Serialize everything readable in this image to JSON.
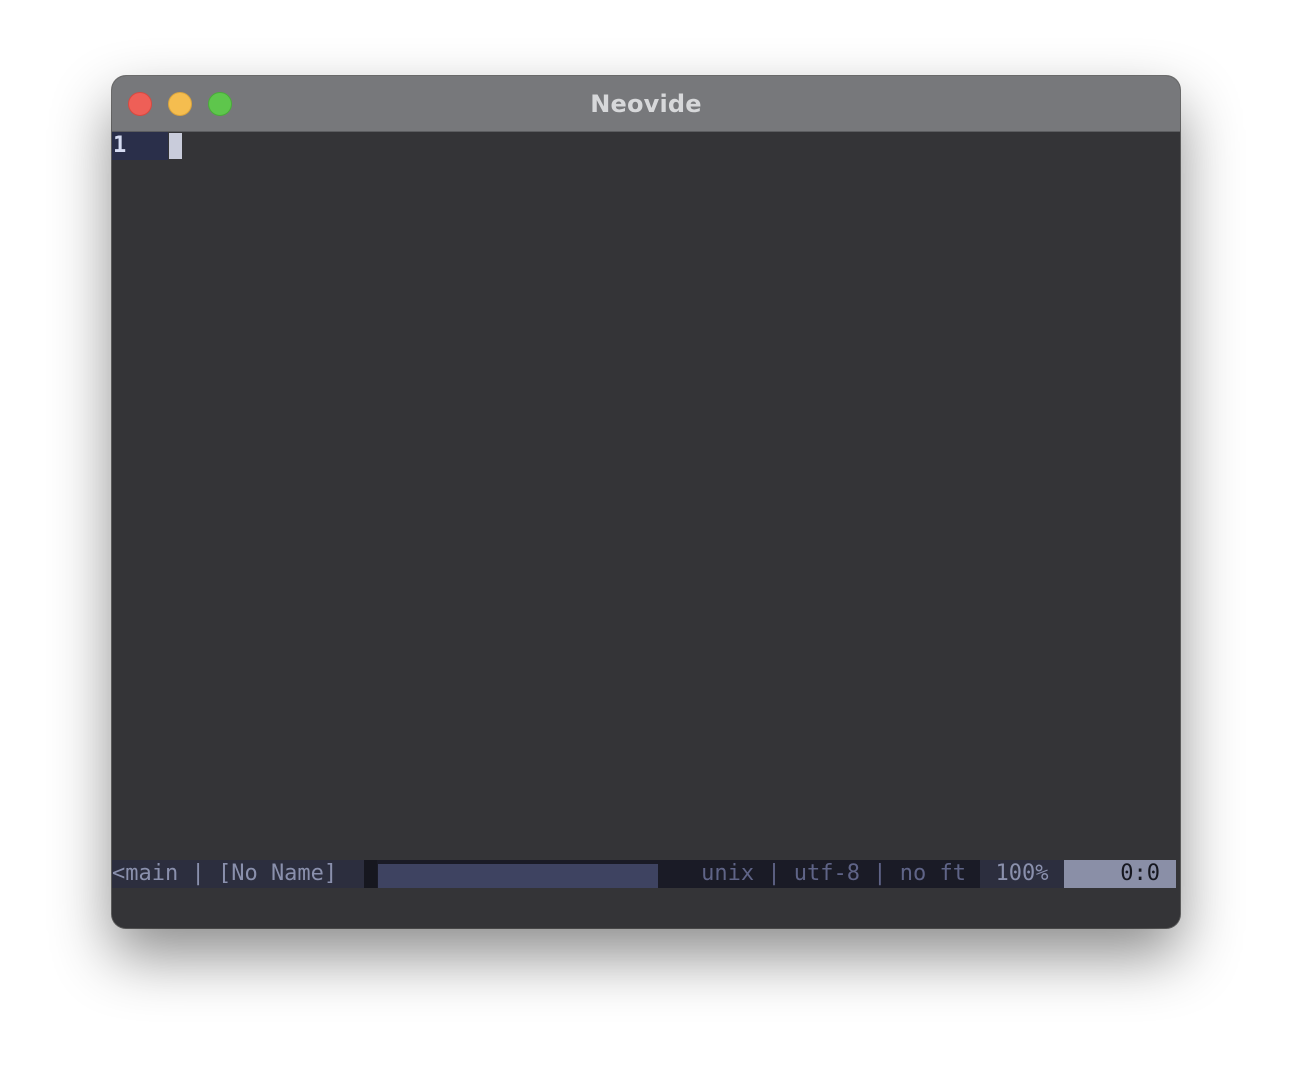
{
  "window": {
    "title": "Neovide"
  },
  "editor": {
    "line_number": "1"
  },
  "statusline": {
    "branch_file": "<main | [No Name]",
    "file_info": "unix | utf-8 | no ft",
    "percent": "100%",
    "position": "0:0"
  },
  "colors": {
    "background": "#343437",
    "titlebar": "#77787b",
    "line_number_bg": "#2a2f4a",
    "statusline_bg": "#2c2e3e",
    "accent": "#8a8fa7"
  }
}
